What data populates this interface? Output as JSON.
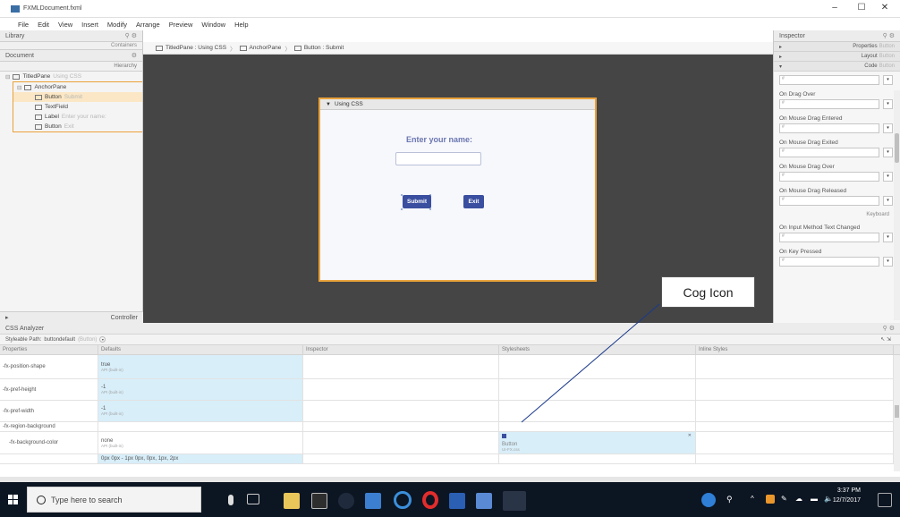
{
  "window": {
    "title": "FXMLDocument.fxml",
    "controls": [
      "–",
      "☐",
      "✕"
    ]
  },
  "menubar": [
    "File",
    "Edit",
    "View",
    "Insert",
    "Modify",
    "Arrange",
    "Preview",
    "Window",
    "Help"
  ],
  "left": {
    "library_label": "Library",
    "containers_label": "Containers",
    "document_label": "Document",
    "hierarchy_label": "Hierarchy",
    "controller_label": "Controller",
    "tree": [
      {
        "type": "TitledPane",
        "sub": "Using CSS"
      },
      {
        "type": "AnchorPane",
        "sub": ""
      },
      {
        "type": "Button",
        "sub": "Submit"
      },
      {
        "type": "TextField",
        "sub": ""
      },
      {
        "type": "Label",
        "sub": "Enter your name:"
      },
      {
        "type": "Button",
        "sub": "Exit"
      }
    ]
  },
  "breadcrumb": [
    "TitledPane : Using CSS",
    "AnchorPane",
    "Button : Submit"
  ],
  "preview": {
    "pane_title": "Using CSS",
    "label": "Enter your name:",
    "submit": "Submit",
    "exit": "Exit"
  },
  "inspector": {
    "title": "Inspector",
    "sections": [
      {
        "name": "Properties",
        "sub": "Button"
      },
      {
        "name": "Layout",
        "sub": "Button"
      },
      {
        "name": "Code",
        "sub": "Button"
      }
    ],
    "props": [
      "On Drag Over",
      "On Mouse Drag Entered",
      "On Mouse Drag Exited",
      "On Mouse Drag Over",
      "On Mouse Drag Released"
    ],
    "keyboard_label": "Keyboard",
    "props2": [
      "On Input Method Text Changed",
      "On Key Pressed"
    ],
    "field_hint": "#"
  },
  "css": {
    "title": "CSS Analyzer",
    "style_path_label": "Styleable Path:",
    "style_path_value": "buttondefault",
    "style_path_sub": "(Button)",
    "columns": [
      "Properties",
      "Defaults",
      "Inspector",
      "Stylesheets",
      "Inline Styles"
    ],
    "rows": [
      {
        "prop": "-fx-position-shape",
        "def": "true",
        "def_sub": "API (built-in)",
        "ss": "",
        "ss_sub": ""
      },
      {
        "prop": "-fx-pref-height",
        "def": "-1",
        "def_sub": "API (built-in)",
        "ss": "",
        "ss_sub": ""
      },
      {
        "prop": "-fx-pref-width",
        "def": "-1",
        "def_sub": "API (built-in)",
        "ss": "",
        "ss_sub": ""
      },
      {
        "prop": "-fx-region-background",
        "def": "",
        "def_sub": "",
        "ss": "",
        "ss_sub": ""
      },
      {
        "prop": "-fx-background-color",
        "def": "none",
        "def_sub": "API (built-in)",
        "ss": "Button",
        "ss_sub": "UI-FX.css"
      },
      {
        "prop": "",
        "def": "0px 0px - 1px 0px, 0px, 1px, 2px",
        "def_sub": "",
        "ss": "",
        "ss_sub": ""
      }
    ]
  },
  "callout": "Cog Icon",
  "taskbar": {
    "search_placeholder": "Type here to search",
    "time": "3:37 PM",
    "date": "12/7/2017"
  },
  "colors": {
    "accent_orange": "#e9a23b",
    "button_blue": "#3a4f9f",
    "taskbar": "#0c1522",
    "canvas": "#454545"
  }
}
